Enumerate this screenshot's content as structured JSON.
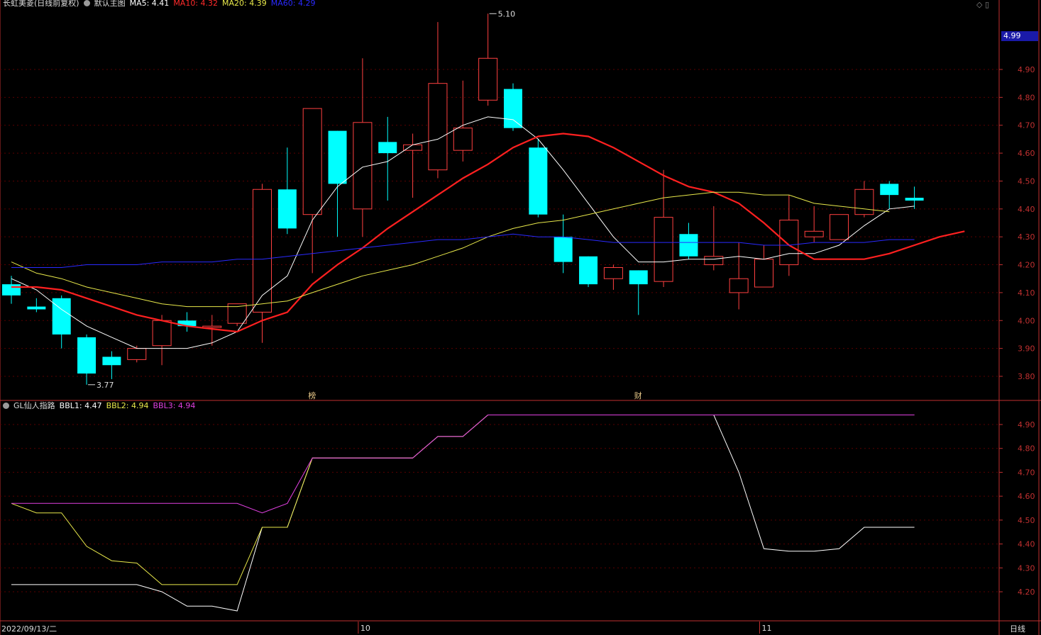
{
  "header": {
    "stock": "长虹美菱(日线前复权)",
    "main_chart": "默认主图",
    "indicators": [
      {
        "label": "MA5: 4.41",
        "color": "#ffffff"
      },
      {
        "label": "MA10: 4.32",
        "color": "#ff2a2a"
      },
      {
        "label": "MA20: 4.39",
        "color": "#e8e84a"
      },
      {
        "label": "MA60: 4.29",
        "color": "#2a2aff"
      }
    ]
  },
  "sub_header": {
    "name": "GL仙人指路",
    "indicators": [
      {
        "label": "BBL1: 4.47",
        "color": "#ffffff"
      },
      {
        "label": "BBL2: 4.94",
        "color": "#e8e84a"
      },
      {
        "label": "BBL3: 4.94",
        "color": "#e040e0"
      }
    ]
  },
  "current_price": "4.99",
  "timeframe": "日线",
  "date_label": "2022/09/13/二",
  "colors": {
    "up": "#ff4040",
    "down": "#00ffff",
    "grid": "#5a0000",
    "axis": "#c03030",
    "ma5": "#ffffff",
    "ma10": "#ff2020",
    "ma20": "#e8e84a",
    "ma60": "#2a2aff",
    "bbl1": "#ffffff",
    "bbl2": "#e8e84a",
    "bbl3": "#e040e0"
  },
  "chart_data": [
    {
      "type": "candlestick",
      "title": "长虹美菱(日线前复权)",
      "y_ticks": [
        "3.80",
        "3.90",
        "4.00",
        "4.10",
        "4.20",
        "4.30",
        "4.40",
        "4.50",
        "4.60",
        "4.70",
        "4.80",
        "4.90"
      ],
      "ylim": [
        3.73,
        5.12
      ],
      "x_labels": [
        {
          "index": 14,
          "label": "10"
        },
        {
          "index": 30,
          "label": "11"
        }
      ],
      "annotations": [
        {
          "index": 19,
          "value": 5.1,
          "text": "5.10"
        },
        {
          "index": 3,
          "value": 3.77,
          "text": "3.77"
        }
      ],
      "event_marks": [
        {
          "index": 12,
          "text": "榜"
        },
        {
          "index": 25,
          "text": "财"
        }
      ],
      "candles": [
        {
          "o": 4.13,
          "h": 4.16,
          "l": 4.06,
          "c": 4.09
        },
        {
          "o": 4.05,
          "h": 4.08,
          "l": 4.03,
          "c": 4.04
        },
        {
          "o": 4.08,
          "h": 4.09,
          "l": 3.9,
          "c": 3.95
        },
        {
          "o": 3.94,
          "h": 3.95,
          "l": 3.77,
          "c": 3.81
        },
        {
          "o": 3.87,
          "h": 3.89,
          "l": 3.79,
          "c": 3.84
        },
        {
          "o": 3.86,
          "h": 3.91,
          "l": 3.85,
          "c": 3.9
        },
        {
          "o": 3.91,
          "h": 4.02,
          "l": 3.84,
          "c": 4.0
        },
        {
          "o": 4.0,
          "h": 4.03,
          "l": 3.96,
          "c": 3.98
        },
        {
          "o": 3.98,
          "h": 4.02,
          "l": 3.91,
          "c": 3.98
        },
        {
          "o": 3.99,
          "h": 4.05,
          "l": 3.98,
          "c": 4.06
        },
        {
          "o": 4.03,
          "h": 4.49,
          "l": 3.92,
          "c": 4.47
        },
        {
          "o": 4.47,
          "h": 4.62,
          "l": 4.31,
          "c": 4.33
        },
        {
          "o": 4.38,
          "h": 4.76,
          "l": 4.17,
          "c": 4.76
        },
        {
          "o": 4.68,
          "h": 4.68,
          "l": 4.3,
          "c": 4.49
        },
        {
          "o": 4.4,
          "h": 4.94,
          "l": 4.3,
          "c": 4.71
        },
        {
          "o": 4.64,
          "h": 4.73,
          "l": 4.43,
          "c": 4.6
        },
        {
          "o": 4.61,
          "h": 4.67,
          "l": 4.44,
          "c": 4.63
        },
        {
          "o": 4.54,
          "h": 5.07,
          "l": 4.51,
          "c": 4.85
        },
        {
          "o": 4.61,
          "h": 4.86,
          "l": 4.57,
          "c": 4.69
        },
        {
          "o": 4.79,
          "h": 5.1,
          "l": 4.77,
          "c": 4.94
        },
        {
          "o": 4.83,
          "h": 4.85,
          "l": 4.68,
          "c": 4.69
        },
        {
          "o": 4.62,
          "h": 4.65,
          "l": 4.37,
          "c": 4.38
        },
        {
          "o": 4.3,
          "h": 4.38,
          "l": 4.17,
          "c": 4.21
        },
        {
          "o": 4.23,
          "h": 4.23,
          "l": 4.12,
          "c": 4.13
        },
        {
          "o": 4.15,
          "h": 4.2,
          "l": 4.11,
          "c": 4.19
        },
        {
          "o": 4.18,
          "h": 4.18,
          "l": 4.02,
          "c": 4.13
        },
        {
          "o": 4.14,
          "h": 4.54,
          "l": 4.12,
          "c": 4.37
        },
        {
          "o": 4.31,
          "h": 4.35,
          "l": 4.22,
          "c": 4.23
        },
        {
          "o": 4.2,
          "h": 4.41,
          "l": 4.18,
          "c": 4.23
        },
        {
          "o": 4.1,
          "h": 4.28,
          "l": 4.04,
          "c": 4.15
        },
        {
          "o": 4.12,
          "h": 4.27,
          "l": 4.12,
          "c": 4.22
        },
        {
          "o": 4.2,
          "h": 4.45,
          "l": 4.16,
          "c": 4.36
        },
        {
          "o": 4.3,
          "h": 4.41,
          "l": 4.28,
          "c": 4.32
        },
        {
          "o": 4.29,
          "h": 4.38,
          "l": 4.29,
          "c": 4.38
        },
        {
          "o": 4.38,
          "h": 4.5,
          "l": 4.37,
          "c": 4.47
        },
        {
          "o": 4.49,
          "h": 4.5,
          "l": 4.4,
          "c": 4.45
        },
        {
          "o": 4.44,
          "h": 4.48,
          "l": 4.4,
          "c": 4.43
        }
      ],
      "series": [
        {
          "name": "MA5",
          "values": [
            4.15,
            4.11,
            4.04,
            3.98,
            3.94,
            3.9,
            3.9,
            3.9,
            3.92,
            3.96,
            4.09,
            4.16,
            4.36,
            4.48,
            4.55,
            4.57,
            4.63,
            4.65,
            4.7,
            4.73,
            4.72,
            4.65,
            4.54,
            4.42,
            4.3,
            4.21,
            4.21,
            4.22,
            4.22,
            4.23,
            4.22,
            4.24,
            4.24,
            4.27,
            4.34,
            4.4,
            4.41
          ]
        },
        {
          "name": "MA10",
          "values": [
            4.12,
            4.12,
            4.11,
            4.08,
            4.05,
            4.02,
            4.0,
            3.98,
            3.97,
            3.96,
            4.0,
            4.03,
            4.13,
            4.2,
            4.26,
            4.33,
            4.39,
            4.45,
            4.51,
            4.56,
            4.62,
            4.66,
            4.67,
            4.66,
            4.62,
            4.57,
            4.52,
            4.48,
            4.46,
            4.42,
            4.35,
            4.27,
            4.22,
            4.22,
            4.22,
            4.24,
            4.27,
            4.3,
            4.32
          ]
        },
        {
          "name": "MA20",
          "values": [
            4.21,
            4.17,
            4.15,
            4.12,
            4.1,
            4.08,
            4.06,
            4.05,
            4.05,
            4.05,
            4.06,
            4.07,
            4.1,
            4.13,
            4.16,
            4.18,
            4.2,
            4.23,
            4.26,
            4.3,
            4.33,
            4.35,
            4.36,
            4.38,
            4.4,
            4.42,
            4.44,
            4.45,
            4.46,
            4.46,
            4.45,
            4.45,
            4.42,
            4.41,
            4.4,
            4.39
          ]
        },
        {
          "name": "MA60",
          "values": [
            4.19,
            4.19,
            4.19,
            4.2,
            4.2,
            4.2,
            4.21,
            4.21,
            4.21,
            4.22,
            4.22,
            4.23,
            4.24,
            4.25,
            4.26,
            4.27,
            4.28,
            4.29,
            4.29,
            4.3,
            4.31,
            4.3,
            4.3,
            4.29,
            4.28,
            4.28,
            4.28,
            4.28,
            4.28,
            4.28,
            4.27,
            4.27,
            4.28,
            4.28,
            4.28,
            4.29,
            4.29
          ]
        }
      ]
    },
    {
      "type": "line",
      "title": "GL仙人指路",
      "y_ticks": [
        "4.20",
        "4.30",
        "4.40",
        "4.50",
        "4.60",
        "4.70",
        "4.80",
        "4.90"
      ],
      "ylim": [
        4.09,
        4.99
      ],
      "series": [
        {
          "name": "BBL1",
          "values": [
            4.23,
            4.23,
            4.23,
            4.23,
            4.23,
            4.23,
            4.2,
            4.14,
            4.14,
            4.12,
            4.47,
            4.47,
            4.76,
            4.76,
            4.76,
            4.76,
            4.76,
            4.85,
            4.85,
            4.94,
            4.94,
            4.94,
            4.94,
            4.94,
            4.94,
            4.94,
            4.94,
            4.94,
            4.94,
            4.7,
            4.38,
            4.37,
            4.37,
            4.38,
            4.47,
            4.47,
            4.47
          ]
        },
        {
          "name": "BBL2",
          "values": [
            4.57,
            4.53,
            4.53,
            4.39,
            4.33,
            4.32,
            4.23,
            4.23,
            4.23,
            4.23,
            4.47,
            4.47,
            4.76,
            4.76,
            4.76,
            4.76,
            4.76,
            4.85,
            4.85,
            4.94,
            4.94,
            4.94,
            4.94,
            4.94,
            4.94,
            4.94,
            4.94,
            4.94,
            4.94,
            4.94,
            4.94,
            4.94,
            4.94,
            4.94,
            4.94,
            4.94,
            4.94
          ]
        },
        {
          "name": "BBL3",
          "values": [
            4.57,
            4.57,
            4.57,
            4.57,
            4.57,
            4.57,
            4.57,
            4.57,
            4.57,
            4.57,
            4.53,
            4.57,
            4.76,
            4.76,
            4.76,
            4.76,
            4.76,
            4.85,
            4.85,
            4.94,
            4.94,
            4.94,
            4.94,
            4.94,
            4.94,
            4.94,
            4.94,
            4.94,
            4.94,
            4.94,
            4.94,
            4.94,
            4.94,
            4.94,
            4.94,
            4.94,
            4.94
          ]
        }
      ]
    }
  ]
}
